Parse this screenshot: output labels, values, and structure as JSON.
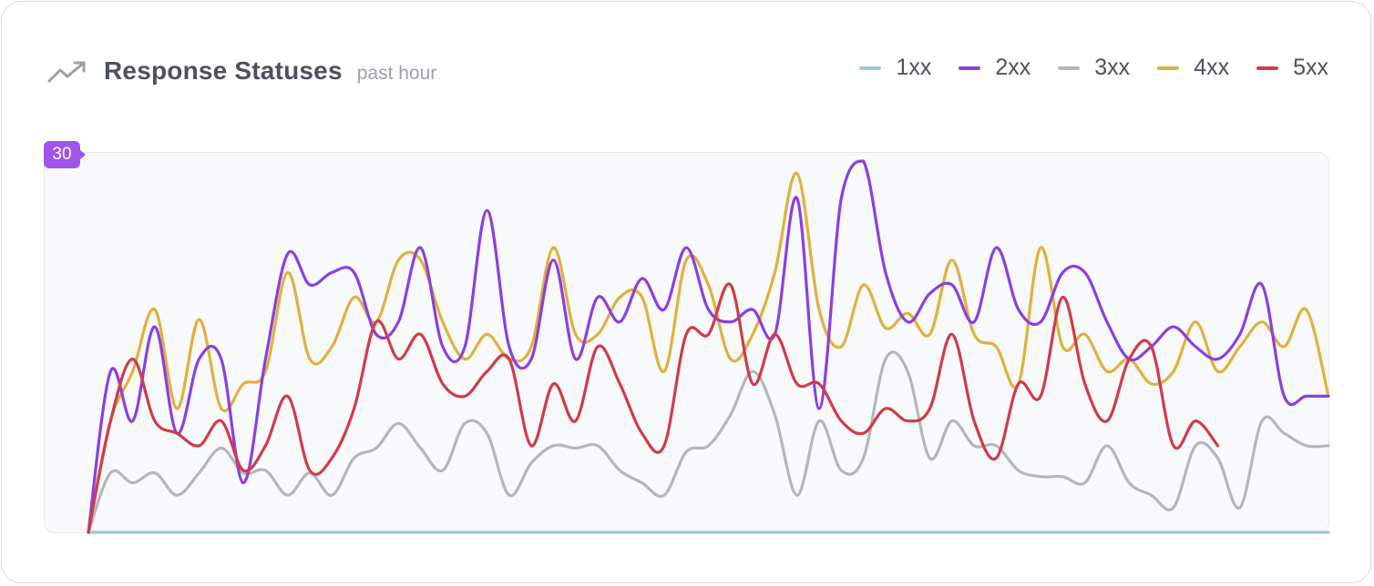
{
  "header": {
    "title": "Response Statuses",
    "subtitle": "past hour",
    "icon": "trending-up-icon"
  },
  "chart_data": {
    "type": "line",
    "title": "Response Statuses",
    "subtitle": "past hour",
    "ylim": [
      0,
      30
    ],
    "y_max_label": "30",
    "grid": false,
    "legend_position": "top-right",
    "x": [
      0,
      1,
      2,
      3,
      4,
      5,
      6,
      7,
      8,
      9,
      10,
      11,
      12,
      13,
      14,
      15,
      16,
      17,
      18,
      19,
      20,
      21,
      22,
      23,
      24,
      25,
      26,
      27,
      28,
      29,
      30,
      31,
      32,
      33,
      34,
      35,
      36,
      37,
      38,
      39,
      40,
      41,
      42,
      43,
      44,
      45,
      46,
      47,
      48,
      49,
      50,
      51,
      52,
      53,
      54,
      55,
      56
    ],
    "series": [
      {
        "name": "1xx",
        "color": "#9ec5d8",
        "values": [
          0,
          0,
          0,
          0,
          0,
          0,
          0,
          0,
          0,
          0,
          0,
          0,
          0,
          0,
          0,
          0,
          0,
          0,
          0,
          0,
          0,
          0,
          0,
          0,
          0,
          0,
          0,
          0,
          0,
          0,
          0,
          0,
          0,
          0,
          0,
          0,
          0,
          0,
          0,
          0,
          0,
          0,
          0,
          0,
          0,
          0,
          0,
          0,
          0,
          0,
          0,
          0,
          0,
          0,
          0,
          0,
          0
        ]
      },
      {
        "name": "3xx",
        "color": "#b5b6bd",
        "values": [
          0,
          4.8,
          4,
          4.8,
          3,
          4.8,
          6.8,
          4.8,
          5,
          3,
          4.8,
          3,
          6,
          6.8,
          8.8,
          6.8,
          5,
          8.8,
          8,
          3,
          5.6,
          7,
          6.8,
          7,
          5,
          4,
          3,
          6.5,
          7,
          9.5,
          13,
          9.5,
          3,
          9,
          5,
          6,
          14,
          13,
          6,
          9,
          7,
          7,
          5,
          4.5,
          4.5,
          4,
          7,
          4,
          3,
          2,
          7,
          6,
          2,
          9,
          8,
          7,
          7
        ]
      },
      {
        "name": "4xx",
        "color": "#e0b13d",
        "values": [
          0,
          9,
          13,
          18,
          10,
          17.2,
          10,
          12,
          13,
          21,
          14,
          15,
          19,
          17,
          22,
          22,
          17,
          14,
          16,
          14,
          15,
          23,
          16,
          16,
          19,
          19,
          13,
          22,
          20,
          14,
          16,
          21,
          29,
          18,
          15,
          20,
          16.5,
          17.7,
          16,
          22,
          16,
          15,
          12,
          23,
          15,
          16,
          13,
          14,
          12,
          13,
          17,
          13,
          15,
          17,
          15,
          18,
          11
        ]
      },
      {
        "name": "2xx",
        "color": "#8c3fe0",
        "values": [
          0,
          13,
          9,
          16.6,
          8,
          14,
          14,
          4,
          14,
          22.5,
          20,
          21,
          21,
          16,
          17,
          23,
          15,
          15,
          26,
          15,
          14,
          22,
          14,
          19,
          17,
          20.5,
          18,
          23,
          18,
          17,
          18,
          16,
          27,
          10,
          27,
          30,
          21,
          17,
          19.3,
          20,
          17,
          23,
          18,
          17,
          21,
          21,
          17,
          14,
          15,
          16.6,
          15,
          14,
          16,
          20,
          11,
          11,
          11
        ]
      },
      {
        "name": "5xx",
        "color": "#d13b48",
        "values": [
          0,
          9,
          14,
          9,
          8,
          7,
          9,
          5,
          7,
          11,
          5,
          6,
          10,
          17,
          14,
          16,
          12,
          11,
          13,
          14,
          7,
          12,
          9,
          15,
          12,
          8,
          7,
          16,
          16,
          20,
          12,
          16,
          12,
          12,
          9,
          8,
          10,
          9,
          10,
          16,
          9,
          6,
          12,
          11,
          19,
          12,
          9,
          14,
          15,
          7,
          9,
          7
        ]
      }
    ]
  }
}
